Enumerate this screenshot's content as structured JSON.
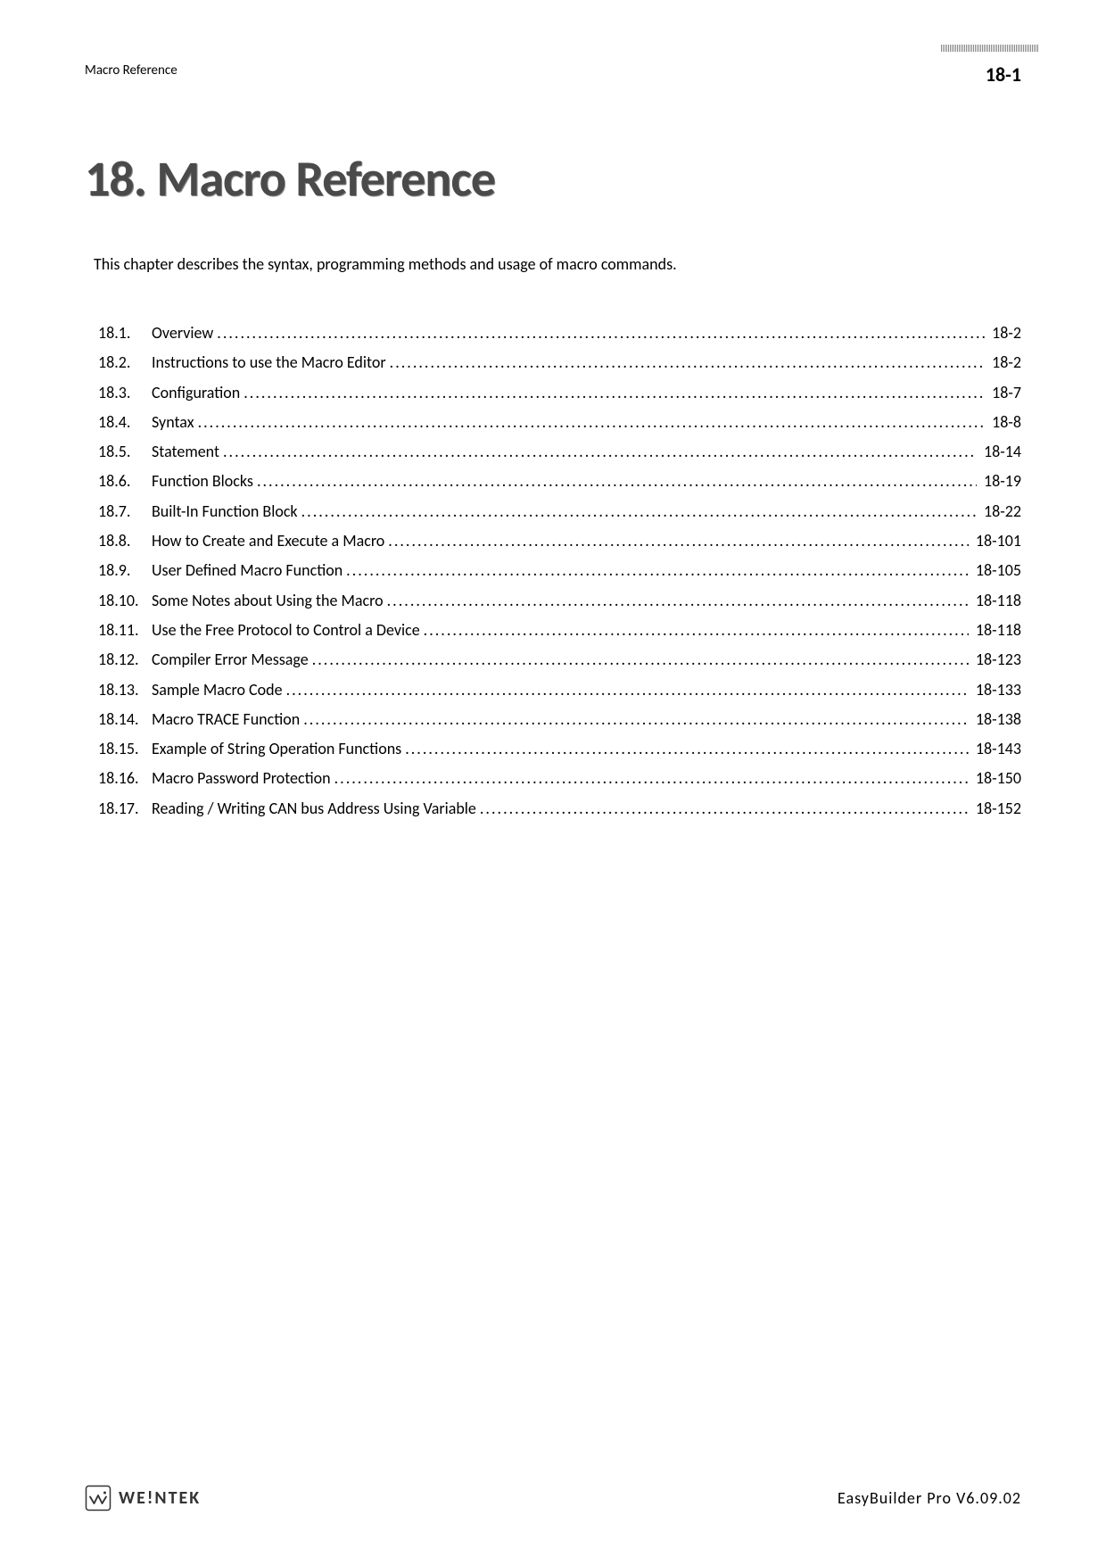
{
  "header": {
    "left": "Macro Reference",
    "right": "18-1"
  },
  "chapter": {
    "title": "18. Macro Reference",
    "intro": "This chapter describes the syntax, programming methods and usage of macro commands."
  },
  "toc": [
    {
      "num": "18.1.",
      "title": "Overview",
      "page": "18-2"
    },
    {
      "num": "18.2.",
      "title": "Instructions to use the Macro Editor",
      "page": "18-2"
    },
    {
      "num": "18.3.",
      "title": "Configuration",
      "page": "18-7"
    },
    {
      "num": "18.4.",
      "title": "Syntax",
      "page": "18-8"
    },
    {
      "num": "18.5.",
      "title": "Statement",
      "page": "18-14"
    },
    {
      "num": "18.6.",
      "title": "Function Blocks",
      "page": "18-19"
    },
    {
      "num": "18.7.",
      "title": "Built-In Function Block",
      "page": "18-22"
    },
    {
      "num": "18.8.",
      "title": "How to Create and Execute a Macro",
      "page": "18-101"
    },
    {
      "num": "18.9.",
      "title": "User Defined Macro Function",
      "page": "18-105"
    },
    {
      "num": "18.10.",
      "title": "Some Notes about Using the Macro",
      "page": "18-118"
    },
    {
      "num": "18.11.",
      "title": "Use the Free Protocol to Control a Device",
      "page": "18-118"
    },
    {
      "num": "18.12.",
      "title": "Compiler Error Message",
      "page": "18-123"
    },
    {
      "num": "18.13.",
      "title": "Sample Macro Code",
      "page": "18-133"
    },
    {
      "num": "18.14.",
      "title": "Macro TRACE Function",
      "page": "18-138"
    },
    {
      "num": "18.15.",
      "title": "Example of String Operation Functions",
      "page": "18-143"
    },
    {
      "num": "18.16.",
      "title": "Macro Password Protection",
      "page": "18-150"
    },
    {
      "num": "18.17.",
      "title": "Reading / Writing CAN bus Address Using Variable",
      "page": "18-152"
    }
  ],
  "footer": {
    "brand": "WE!NTEK",
    "product": "EasyBuilder Pro V6.09.02"
  }
}
